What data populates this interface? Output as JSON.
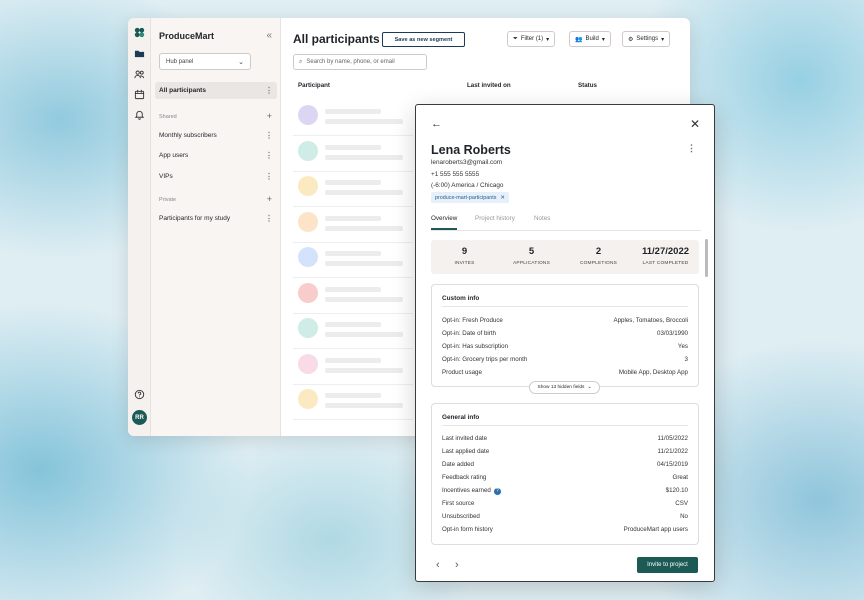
{
  "app": {
    "brand": "ProduceMart",
    "hub_select": "Hub panel",
    "rail_icons": [
      "folder-icon",
      "people-icon",
      "calendar-icon",
      "bell-icon",
      "help-icon"
    ],
    "user_initials": "RR"
  },
  "sidebar": {
    "all_participants": "All participants",
    "shared_heading": "Shared",
    "shared_items": [
      "Monthly subscribers",
      "App users",
      "VIPs"
    ],
    "private_heading": "Private",
    "private_items": [
      "Participants for my study"
    ]
  },
  "main": {
    "title": "All participants",
    "save_segment": "Save as new segment",
    "filter": "Filter (1)",
    "build": "Build",
    "settings": "Settings",
    "search_placeholder": "Search by name, phone, or email",
    "columns": [
      "Participant",
      "Last invited on",
      "Status"
    ],
    "avatar_colors": [
      "#ddd6f3",
      "#cfece6",
      "#fbe9c2",
      "#fde3c7",
      "#d4e3fb",
      "#f8cccb",
      "#cfece6",
      "#f8dbe6",
      "#fbe9c2"
    ]
  },
  "profile": {
    "name": "Lena Roberts",
    "email": "lenaroberts3@gmail.com",
    "phone": "+1 555 555 5555",
    "timezone": "(-6:00) America / Chicago",
    "tag": "produce-mart-participants",
    "tabs": [
      "Overview",
      "Project history",
      "Notes"
    ],
    "stats": [
      {
        "value": "9",
        "label": "INVITES"
      },
      {
        "value": "5",
        "label": "APPLICATIONS"
      },
      {
        "value": "2",
        "label": "COMPLETIONS"
      },
      {
        "value": "11/27/2022",
        "label": "LAST COMPLETED"
      }
    ],
    "custom_info": {
      "title": "Custom info",
      "rows": [
        {
          "k": "Opt-in: Fresh Produce",
          "v": "Apples, Tomatoes, Broccoli"
        },
        {
          "k": "Opt-in: Date of birth",
          "v": "03/03/1990"
        },
        {
          "k": "Opt-in: Has subscription",
          "v": "Yes"
        },
        {
          "k": "Opt-in: Grocery trips per month",
          "v": "3"
        },
        {
          "k": "Product usage",
          "v": "Mobile App, Desktop App"
        }
      ],
      "show_hidden": "Show 13 hidden fields"
    },
    "general_info": {
      "title": "General info",
      "rows": [
        {
          "k": "Last invited date",
          "v": "11/05/2022"
        },
        {
          "k": "Last applied date",
          "v": "11/21/2022"
        },
        {
          "k": "Date added",
          "v": "04/15/2019"
        },
        {
          "k": "Feedback rating",
          "v": "Great"
        },
        {
          "k": "Incentives earned",
          "v": "$120.10"
        },
        {
          "k": "First source",
          "v": "CSV"
        },
        {
          "k": "Unsubscribed",
          "v": "No"
        },
        {
          "k": "Opt-in form history",
          "v": "ProduceMart app users"
        }
      ]
    },
    "invite_button": "Invite to project"
  }
}
